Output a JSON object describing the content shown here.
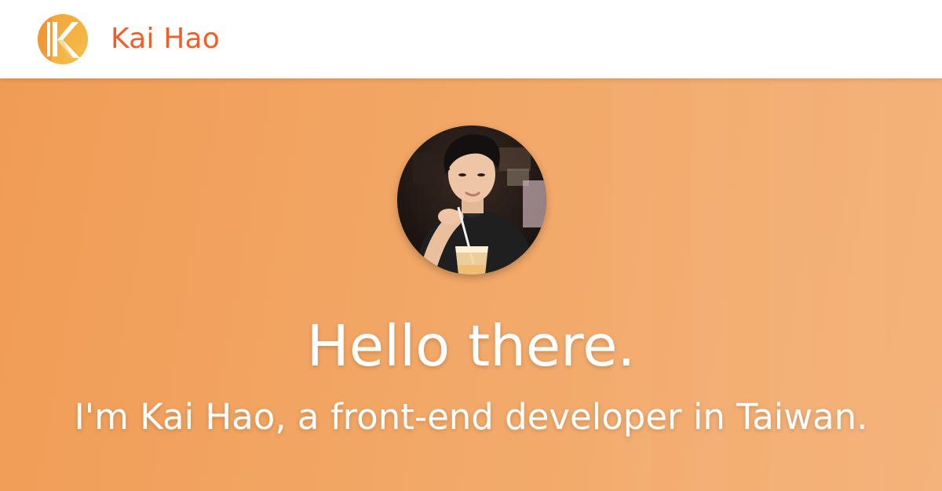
{
  "header": {
    "logo_icon": "k-logo-icon",
    "brand_name": "Kai Hao"
  },
  "hero": {
    "avatar_icon": "profile-photo",
    "headline": "Hello there.",
    "subheadline": "I'm Kai Hao, a front-end developer in Taiwan."
  },
  "colors": {
    "brand": "#ee5f2a",
    "hero_start": "#f19c55",
    "hero_end": "#f4b37a",
    "logo_gold": "#f3b23a",
    "logo_orange": "#ee7a2a"
  }
}
